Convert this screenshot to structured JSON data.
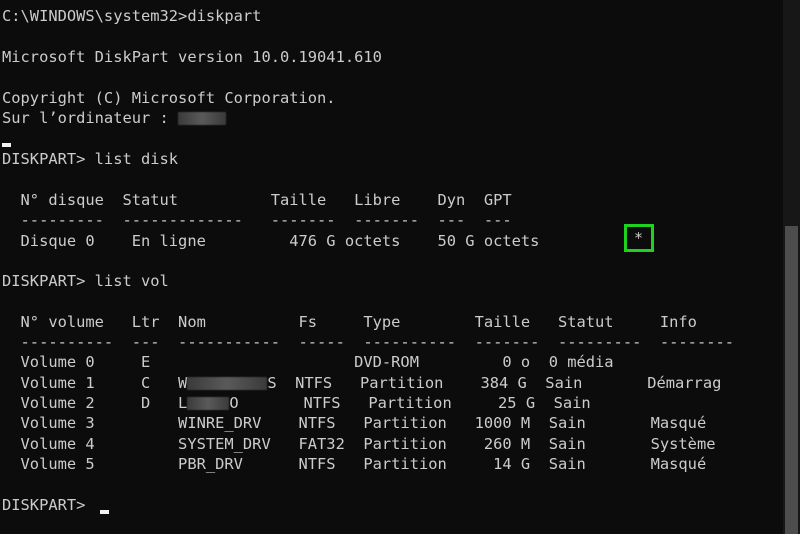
{
  "console": {
    "cmd_prompt_line": "C:\\WINDOWS\\system32>diskpart",
    "version_line": "Microsoft DiskPart version 10.0.19041.610",
    "copyright_line": "Copyright (C) Microsoft Corporation.",
    "computer_label": "Sur l’ordinateur : ",
    "cmd_list_disk": "DISKPART> list disk",
    "disk_header": "  N° disque  Statut          Taille   Libre    Dyn  GPT",
    "disk_separator": "  ---------  -------------   -------  -------  ---  ---",
    "disk_rows": [
      "  Disque 0    En ligne         476 G octets    50 G octets"
    ],
    "gpt_marker": "*",
    "cmd_list_vol": "DISKPART> list vol",
    "vol_header": "  N° volume   Ltr  Nom          Fs     Type        Taille   Statut     Info",
    "vol_separator": "  ----------  ---  -----------  -----  ----------  -------  ---------  --------",
    "vol_rows": [
      {
        "line": "  Volume 0     E                      DVD-ROM         0 o  0 média"
      },
      {
        "before": "  Volume 1     C   W",
        "redact_chars": 8,
        "after": "S  NTFS   Partition    384 G  Sain       Démarrag"
      },
      {
        "before": "  Volume 2     D   L",
        "redact_chars": 4,
        "after": "O       NTFS   Partition     25 G  Sain"
      },
      {
        "line": "  Volume 3         WINRE_DRV    NTFS   Partition   1000 M  Sain       Masqué"
      },
      {
        "line": "  Volume 4         SYSTEM_DRV   FAT32  Partition    260 M  Sain       Système"
      },
      {
        "line": "  Volume 5         PBR_DRV      NTFS   Partition     14 G  Sain       Masqué"
      }
    ],
    "final_prompt": "DISKPART> "
  }
}
